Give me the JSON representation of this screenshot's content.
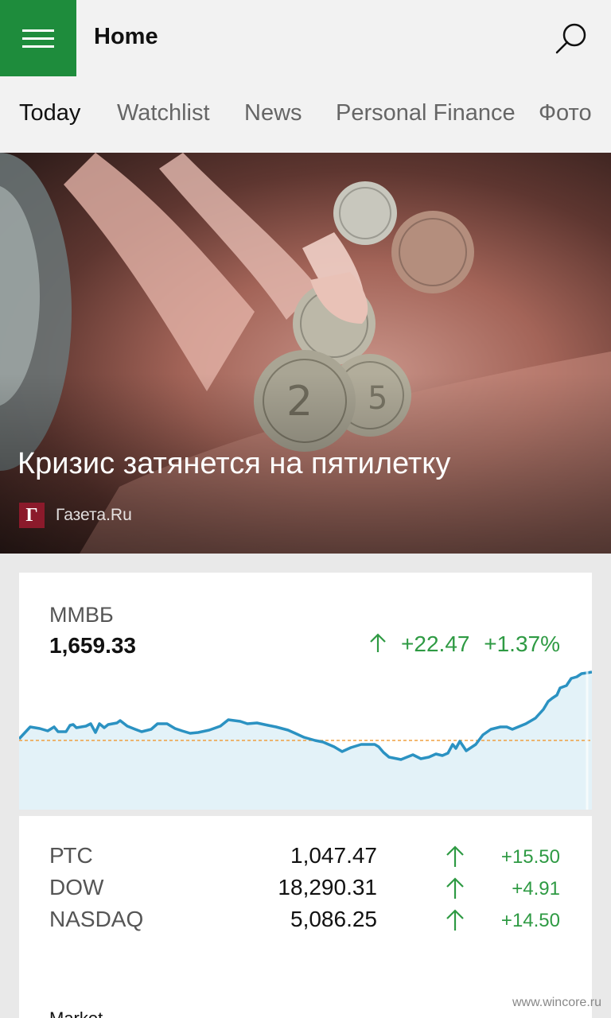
{
  "header": {
    "title": "Home",
    "menu_icon": "hamburger-icon",
    "search_icon": "search-icon",
    "accent": "#1e8c3c"
  },
  "tabs": [
    {
      "label": "Today",
      "active": true
    },
    {
      "label": "Watchlist"
    },
    {
      "label": "News"
    },
    {
      "label": "Personal Finance"
    },
    {
      "label": "Фото"
    }
  ],
  "hero": {
    "title": "Кризис затянется на пятилетку",
    "source": "Газета.Ru",
    "source_logo": "Г"
  },
  "index": {
    "name": "ММВБ",
    "value": "1,659.33",
    "change": "+22.47",
    "change_pct": "+1.37%",
    "trend": "up"
  },
  "quotes": [
    {
      "name": "РТС",
      "value": "1,047.47",
      "change": "+15.50",
      "trend": "up"
    },
    {
      "name": "DOW",
      "value": "18,290.31",
      "change": "+4.91",
      "trend": "up"
    },
    {
      "name": "NASDAQ",
      "value": "5,086.25",
      "change": "+14.50",
      "trend": "up"
    }
  ],
  "market_label": "Market",
  "watermark": "www.wincore.ru",
  "colors": {
    "up": "#2e9a43",
    "line": "#2b92c2",
    "fill": "#e3f2f8",
    "baseline": "#f0a040"
  }
}
